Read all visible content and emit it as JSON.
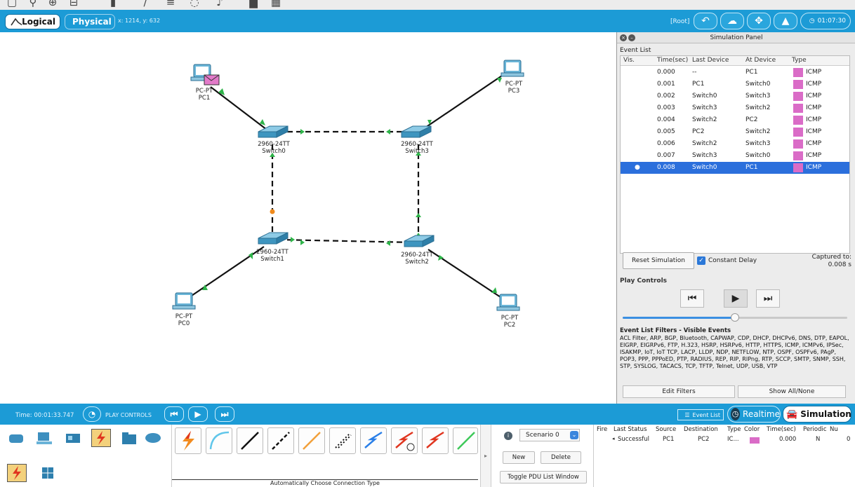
{
  "toolbar": {
    "icons": [
      "zoom-icon",
      "search-icon",
      "zoom-in-icon",
      "zoom-out-icon",
      "clipboard-icon",
      "pencil-icon",
      "list-icon",
      "ellipse-icon",
      "note-icon",
      "custom-icon",
      "grid-icon"
    ]
  },
  "header": {
    "tab_logical": "Logical",
    "tab_physical": "Physical",
    "coords": "x: 1214, y: 632",
    "root": "[Root]",
    "clock": "01:07:30"
  },
  "topology": {
    "devices": [
      {
        "id": "pc1",
        "model": "PC-PT",
        "name": "PC1"
      },
      {
        "id": "pc3",
        "model": "PC-PT",
        "name": "PC3"
      },
      {
        "id": "switch0",
        "model": "2960-24TT",
        "name": "Switch0"
      },
      {
        "id": "switch3",
        "model": "2960-24TT",
        "name": "Switch3"
      },
      {
        "id": "switch1",
        "model": "2960-24TT",
        "name": "Switch1"
      },
      {
        "id": "switch2",
        "model": "2960-24TT",
        "name": "Switch2"
      },
      {
        "id": "pc0",
        "model": "PC-PT",
        "name": "PC0"
      },
      {
        "id": "pc2",
        "model": "PC-PT",
        "name": "PC2"
      }
    ]
  },
  "sim_panel": {
    "title": "Simulation Panel",
    "event_list_label": "Event List",
    "columns": [
      "Vis.",
      "Time(sec)",
      "Last Device",
      "At Device",
      "Type"
    ],
    "events": [
      {
        "time": "0.000",
        "last": "--",
        "at": "PC1",
        "type": "ICMP"
      },
      {
        "time": "0.001",
        "last": "PC1",
        "at": "Switch0",
        "type": "ICMP"
      },
      {
        "time": "0.002",
        "last": "Switch0",
        "at": "Switch3",
        "type": "ICMP"
      },
      {
        "time": "0.003",
        "last": "Switch3",
        "at": "Switch2",
        "type": "ICMP"
      },
      {
        "time": "0.004",
        "last": "Switch2",
        "at": "PC2",
        "type": "ICMP"
      },
      {
        "time": "0.005",
        "last": "PC2",
        "at": "Switch2",
        "type": "ICMP"
      },
      {
        "time": "0.006",
        "last": "Switch2",
        "at": "Switch3",
        "type": "ICMP"
      },
      {
        "time": "0.007",
        "last": "Switch3",
        "at": "Switch0",
        "type": "ICMP"
      },
      {
        "time": "0.008",
        "last": "Switch0",
        "at": "PC1",
        "type": "ICMP"
      }
    ],
    "icmp_color": "#da6cc7",
    "selected_color": "#2b6fdc",
    "reset_label": "Reset Simulation",
    "constant_delay": "Constant Delay",
    "captured_label": "Captured to:",
    "captured_value": "0.008 s",
    "play_controls_label": "Play Controls",
    "slider_fraction": 0.5,
    "filters_label": "Event List Filters - Visible Events",
    "filters_text": "ACL Filter, ARP, BGP, Bluetooth, CAPWAP, CDP, DHCP, DHCPv6, DNS, DTP, EAPOL, EIGRP, EIGRPv6, FTP, H.323, HSRP, HSRPv6, HTTP, HTTPS, ICMP, ICMPv6, IPSec, ISAKMP, IoT, IoT TCP, LACP, LLDP, NDP, NETFLOW, NTP, OSPF, OSPFv6, PAgP, POP3, PPP, PPPoED, PTP, RADIUS, REP, RIP, RIPng, RTP, SCCP, SMTP, SNMP, SSH, STP, SYSLOG, TACACS, TCP, TFTP, Telnet, UDP, USB, VTP",
    "edit_filters": "Edit Filters",
    "show_all": "Show All/None"
  },
  "bottom_bar": {
    "time": "Time: 00:01:33.747",
    "play_controls": "PLAY CONTROLS",
    "event_list_btn": "Event List",
    "realtime": "Realtime",
    "simulation": "Simulation"
  },
  "scenario": {
    "selected": "Scenario 0",
    "new_label": "New",
    "delete_label": "Delete",
    "toggle_label": "Toggle PDU List Window"
  },
  "pdu_list": {
    "columns": [
      "Fire",
      "Last Status",
      "Source",
      "Destination",
      "Type",
      "Color",
      "Time(sec)",
      "Periodic",
      "Nu"
    ],
    "rows": [
      {
        "fire": "",
        "status": "Successful",
        "source": "PC1",
        "destination": "PC2",
        "type": "IC...",
        "time": "0.000",
        "periodic": "N",
        "num": "0"
      }
    ]
  },
  "connections_panel": {
    "label": "Automatically Choose Connection Type"
  }
}
